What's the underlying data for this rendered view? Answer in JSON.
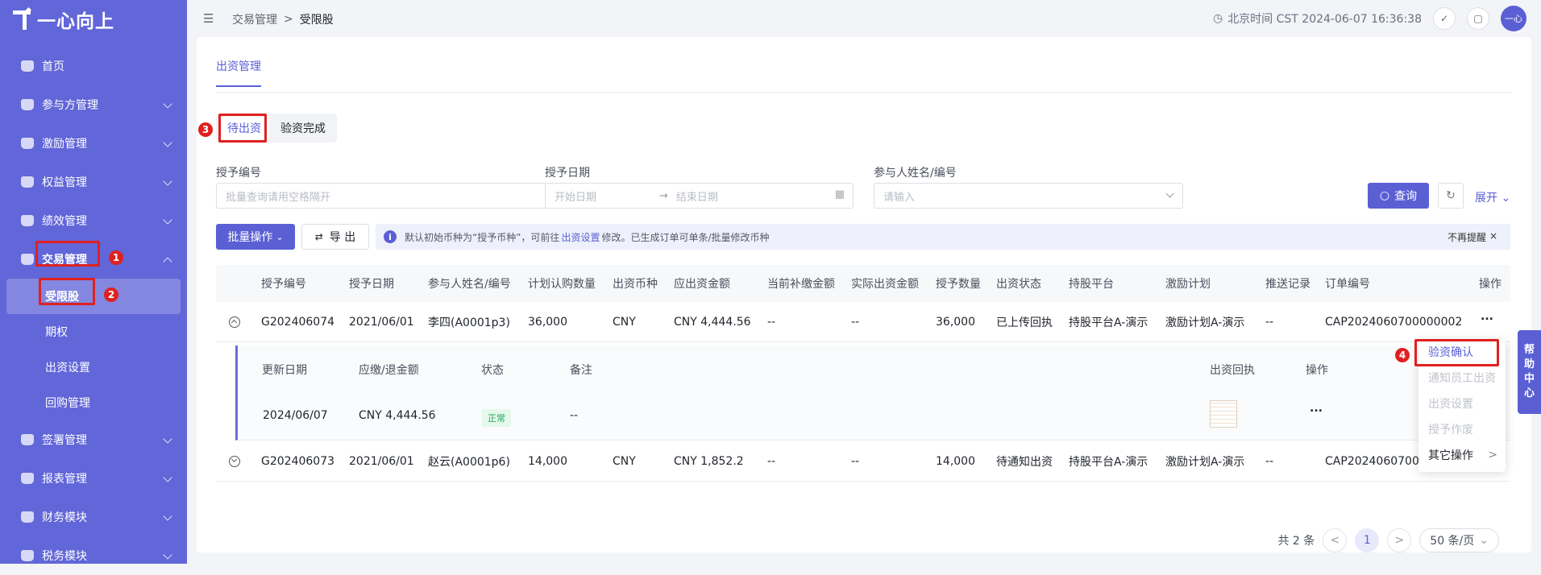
{
  "brand": {
    "name": "一心向上"
  },
  "sidebar": {
    "items": [
      {
        "label": "首页",
        "icon": "home-icon"
      },
      {
        "label": "参与方管理",
        "icon": "users-icon"
      },
      {
        "label": "激励管理",
        "icon": "gift-icon"
      },
      {
        "label": "权益管理",
        "icon": "rights-icon"
      },
      {
        "label": "绩效管理",
        "icon": "chart-icon"
      },
      {
        "label": "交易管理",
        "icon": "trade-icon",
        "expanded": true
      },
      {
        "label": "签署管理",
        "icon": "sign-icon"
      },
      {
        "label": "报表管理",
        "icon": "report-icon"
      },
      {
        "label": "财务模块",
        "icon": "finance-icon"
      },
      {
        "label": "税务模块",
        "icon": "tax-icon"
      }
    ],
    "sub_items": [
      {
        "label": "受限股",
        "active": true
      },
      {
        "label": "期权"
      },
      {
        "label": "出资设置"
      },
      {
        "label": "回购管理"
      }
    ]
  },
  "breadcrumb": {
    "parent": "交易管理",
    "separator": ">",
    "current": "受限股"
  },
  "header": {
    "time": "北京时间 CST 2024-06-07 16:36:38",
    "avatar": "一心"
  },
  "page_tab": "出资管理",
  "segments": [
    "待出资",
    "验资完成"
  ],
  "filters": {
    "grant_no_label": "授予编号",
    "grant_no_placeholder": "批量查询请用空格隔开",
    "grant_date_label": "授予日期",
    "start_placeholder": "开始日期",
    "arrow": "→",
    "end_placeholder": "结束日期",
    "participant_label": "参与人姓名/编号",
    "participant_placeholder": "请输入",
    "query": "查询",
    "expand": "展开"
  },
  "toolbar": {
    "batch": "批量操作",
    "export": "导 出"
  },
  "notice": {
    "pre": "默认初始币种为“授予币种”，可前往",
    "link": "出资设置",
    "post": "修改。已生成订单可单条/批量修改币种",
    "dismiss": "不再提醒"
  },
  "table": {
    "headers": [
      "授予编号",
      "授予日期",
      "参与人姓名/编号",
      "计划认购数量",
      "出资币种",
      "应出资金额",
      "当前补缴金额",
      "实际出资金额",
      "授予数量",
      "出资状态",
      "持股平台",
      "激励计划",
      "推送记录",
      "订单编号",
      "操作"
    ],
    "rows": [
      [
        "G202406074",
        "2021/06/01",
        "李四(A0001p3)",
        "36,000",
        "CNY",
        "CNY 4,444.56",
        "--",
        "--",
        "36,000",
        "已上传回执",
        "持股平台A-演示",
        "激励计划A-演示",
        "--",
        "CAP2024060700000002"
      ],
      [
        "G202406073",
        "2021/06/01",
        "赵云(A0001p6)",
        "14,000",
        "CNY",
        "CNY 1,852.2",
        "--",
        "--",
        "14,000",
        "待通知出资",
        "持股平台A-演示",
        "激励计划A-演示",
        "--",
        "CAP2024060700"
      ]
    ],
    "more": "..."
  },
  "subtable": {
    "headers": [
      "更新日期",
      "应缴/退金额",
      "状态",
      "备注",
      "出资回执",
      "操作"
    ],
    "row": {
      "date": "2024/06/07",
      "amount": "CNY 4,444.56",
      "status": "正常",
      "note": "--",
      "more": "..."
    }
  },
  "dropdown": [
    "验资确认",
    "通知员工出资",
    "出资设置",
    "授予作废",
    "其它操作"
  ],
  "help": [
    "帮",
    "助",
    "中",
    "心"
  ],
  "pagination": {
    "total": "共 2 条",
    "current": "1",
    "size": "50 条/页",
    "prev": "<",
    "next": ">"
  },
  "steps": [
    "1",
    "2",
    "3",
    "4"
  ],
  "colors": {
    "sidebar": "#6166d8",
    "primary": "#5a5fd4",
    "highlight": "#e02020"
  }
}
